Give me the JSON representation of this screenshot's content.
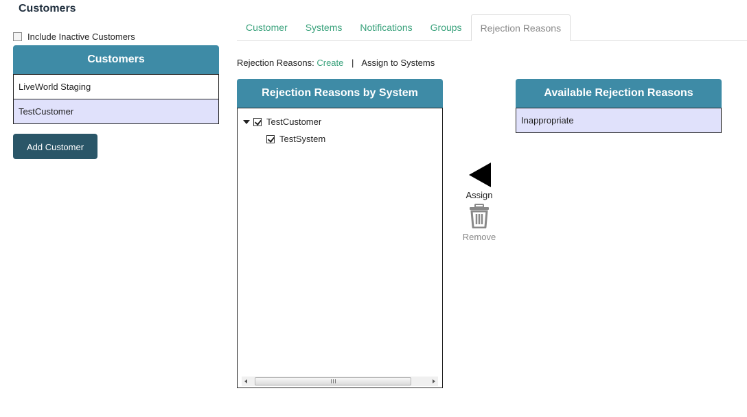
{
  "page": {
    "title": "Customers"
  },
  "filters": {
    "include_inactive_label": "Include Inactive Customers",
    "include_inactive_checked": false
  },
  "customers_panel": {
    "title": "Customers",
    "items": [
      {
        "label": "LiveWorld Staging",
        "selected": false
      },
      {
        "label": "TestCustomer",
        "selected": true
      }
    ],
    "add_button_label": "Add Customer"
  },
  "tabs": [
    {
      "label": "Customer",
      "active": false
    },
    {
      "label": "Systems",
      "active": false
    },
    {
      "label": "Notifications",
      "active": false
    },
    {
      "label": "Groups",
      "active": false
    },
    {
      "label": "Rejection Reasons",
      "active": true
    }
  ],
  "rejection_reasons": {
    "prefix": "Rejection Reasons:",
    "create_link": "Create",
    "separator": "|",
    "assign_link": "Assign to Systems"
  },
  "by_system_panel": {
    "title": "Rejection Reasons by System",
    "tree": [
      {
        "label": "TestCustomer",
        "checked": true,
        "expanded": true,
        "children": [
          {
            "label": "TestSystem",
            "checked": true
          }
        ]
      }
    ]
  },
  "actions": {
    "assign_label": "Assign",
    "remove_label": "Remove"
  },
  "available_panel": {
    "title": "Available Rejection Reasons",
    "items": [
      {
        "label": "Inappropriate",
        "selected": true
      }
    ]
  },
  "colors": {
    "panel_header": "#3e8ba6",
    "button_bg": "#2a5668",
    "link": "#3aa27c",
    "selected_row": "#e0e1fb"
  }
}
